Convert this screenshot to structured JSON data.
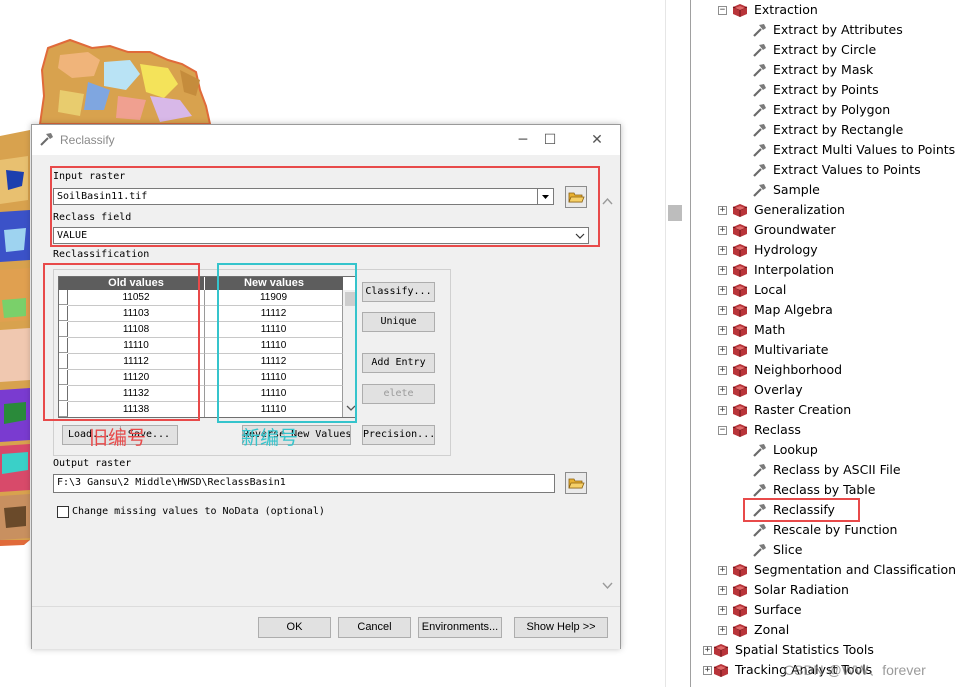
{
  "dialog": {
    "title": "Reclassify",
    "minimize": "─",
    "maximize": "☐",
    "close": "✕",
    "input_raster_label": "Input raster",
    "input_raster_value": "SoilBasin11.tif",
    "reclass_field_label": "Reclass field",
    "reclass_field_value": "VALUE",
    "reclassification_label": "Reclassification",
    "table": {
      "headers": [
        "Old values",
        "New values"
      ],
      "rows": [
        [
          "11052",
          "11909"
        ],
        [
          "11103",
          "11112"
        ],
        [
          "11108",
          "11110"
        ],
        [
          "11110",
          "11110"
        ],
        [
          "11112",
          "11112"
        ],
        [
          "11120",
          "11110"
        ],
        [
          "11132",
          "11110"
        ],
        [
          "11138",
          "11110"
        ]
      ]
    },
    "buttons": {
      "classify": "Classify...",
      "unique": "Unique",
      "add_entry": "Add Entry",
      "delete_entries": "elete Entrie",
      "load": "Load...",
      "save": "Save...",
      "reverse": "Reverse New Values",
      "precision": "Precision..."
    },
    "annotations": {
      "old_id": "旧编号",
      "new_id": "新编号"
    },
    "output_raster_label": "Output raster",
    "output_raster_value": "F:\\3 Gansu\\2 Middle\\HWSD\\ReclassBasin1",
    "nodata_label": "Change missing values to NoData (optional)",
    "footer": {
      "ok": "OK",
      "cancel": "Cancel",
      "environments": "Environments...",
      "show_help": "Show Help >>"
    }
  },
  "tree": {
    "items": [
      {
        "label": "Extraction",
        "type": "toolbox",
        "expanded": true,
        "level": 1
      },
      {
        "label": "Extract by Attributes",
        "type": "tool",
        "level": 2
      },
      {
        "label": "Extract by Circle",
        "type": "tool",
        "level": 2
      },
      {
        "label": "Extract by Mask",
        "type": "tool",
        "level": 2
      },
      {
        "label": "Extract by Points",
        "type": "tool",
        "level": 2
      },
      {
        "label": "Extract by Polygon",
        "type": "tool",
        "level": 2
      },
      {
        "label": "Extract by Rectangle",
        "type": "tool",
        "level": 2
      },
      {
        "label": "Extract Multi Values to Points",
        "type": "tool",
        "level": 2
      },
      {
        "label": "Extract Values to Points",
        "type": "tool",
        "level": 2
      },
      {
        "label": "Sample",
        "type": "tool",
        "level": 2
      },
      {
        "label": "Generalization",
        "type": "toolbox",
        "expanded": false,
        "level": 1
      },
      {
        "label": "Groundwater",
        "type": "toolbox",
        "expanded": false,
        "level": 1
      },
      {
        "label": "Hydrology",
        "type": "toolbox",
        "expanded": false,
        "level": 1
      },
      {
        "label": "Interpolation",
        "type": "toolbox",
        "expanded": false,
        "level": 1
      },
      {
        "label": "Local",
        "type": "toolbox",
        "expanded": false,
        "level": 1
      },
      {
        "label": "Map Algebra",
        "type": "toolbox",
        "expanded": false,
        "level": 1
      },
      {
        "label": "Math",
        "type": "toolbox",
        "expanded": false,
        "level": 1
      },
      {
        "label": "Multivariate",
        "type": "toolbox",
        "expanded": false,
        "level": 1
      },
      {
        "label": "Neighborhood",
        "type": "toolbox",
        "expanded": false,
        "level": 1
      },
      {
        "label": "Overlay",
        "type": "toolbox",
        "expanded": false,
        "level": 1
      },
      {
        "label": "Raster Creation",
        "type": "toolbox",
        "expanded": false,
        "level": 1
      },
      {
        "label": "Reclass",
        "type": "toolbox",
        "expanded": true,
        "level": 1
      },
      {
        "label": "Lookup",
        "type": "tool",
        "level": 2
      },
      {
        "label": "Reclass by ASCII File",
        "type": "tool",
        "level": 2
      },
      {
        "label": "Reclass by Table",
        "type": "tool",
        "level": 2
      },
      {
        "label": "Reclassify",
        "type": "tool",
        "level": 2,
        "highlighted": true
      },
      {
        "label": "Rescale by Function",
        "type": "tool",
        "level": 2
      },
      {
        "label": "Slice",
        "type": "tool",
        "level": 2
      },
      {
        "label": "Segmentation and Classification",
        "type": "toolbox",
        "expanded": false,
        "level": 1
      },
      {
        "label": "Solar Radiation",
        "type": "toolbox",
        "expanded": false,
        "level": 1
      },
      {
        "label": "Surface",
        "type": "toolbox",
        "expanded": false,
        "level": 1
      },
      {
        "label": "Zonal",
        "type": "toolbox",
        "expanded": false,
        "level": 1
      },
      {
        "label": "Spatial Statistics Tools",
        "type": "toolbox",
        "expanded": false,
        "level": 0
      },
      {
        "label": "Tracking Analyst Tools",
        "type": "toolbox",
        "expanded": false,
        "level": 0
      }
    ],
    "watermark": "CSDN @WW、forever"
  },
  "colors": {
    "highlight_red": "#e84a4a",
    "highlight_cyan": "#35c4cc",
    "toolbox_red": "#b8343a",
    "table_header": "#5d5d5d"
  }
}
